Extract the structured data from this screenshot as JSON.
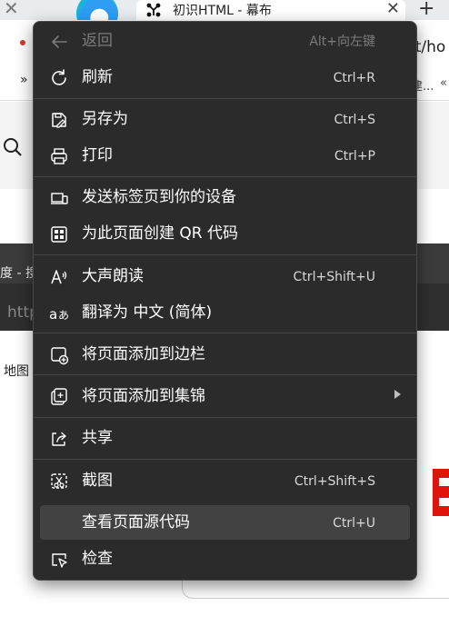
{
  "background": {
    "tab_title": "初识HTML - 幕布",
    "tab_close": "✕",
    "new_tab": "+",
    "left_close": "✕",
    "address_tail": "it/ho",
    "bookmark_left": "»",
    "bookmark_right": "建...",
    "bookmark_right2": "«",
    "dark_strip_text": "度 - 搜",
    "http_text": "http",
    "map_text": "地图"
  },
  "menu": {
    "items": [
      {
        "label": "返回",
        "shortcut": "Alt+向左键",
        "icon": "back-arrow-icon",
        "disabled": true
      },
      {
        "label": "刷新",
        "shortcut": "Ctrl+R",
        "icon": "refresh-icon"
      },
      {
        "label": "另存为",
        "shortcut": "Ctrl+S",
        "icon": "save-as-icon"
      },
      {
        "label": "打印",
        "shortcut": "Ctrl+P",
        "icon": "print-icon"
      },
      {
        "label": "发送标签页到你的设备",
        "shortcut": "",
        "icon": "send-to-device-icon"
      },
      {
        "label": "为此页面创建 QR 代码",
        "shortcut": "",
        "icon": "qr-code-icon"
      },
      {
        "label": "大声朗读",
        "shortcut": "Ctrl+Shift+U",
        "icon": "read-aloud-icon"
      },
      {
        "label": "翻译为 中文 (简体)",
        "shortcut": "",
        "icon": "translate-icon"
      },
      {
        "label": "将页面添加到边栏",
        "shortcut": "",
        "icon": "add-to-sidebar-icon"
      },
      {
        "label": "将页面添加到集锦",
        "shortcut": "",
        "icon": "add-to-collections-icon",
        "submenu": true
      },
      {
        "label": "共享",
        "shortcut": "",
        "icon": "share-icon"
      },
      {
        "label": "截图",
        "shortcut": "Ctrl+Shift+S",
        "icon": "screenshot-icon"
      },
      {
        "label": "查看页面源代码",
        "shortcut": "Ctrl+U",
        "icon": "",
        "highlighted": true
      },
      {
        "label": "检查",
        "shortcut": "",
        "icon": "inspect-icon"
      }
    ]
  },
  "colors": {
    "menu_background": "#2b2b2b",
    "menu_hover": "#424242",
    "text": "#ffffff",
    "disabled_text": "#7b7b7b"
  }
}
